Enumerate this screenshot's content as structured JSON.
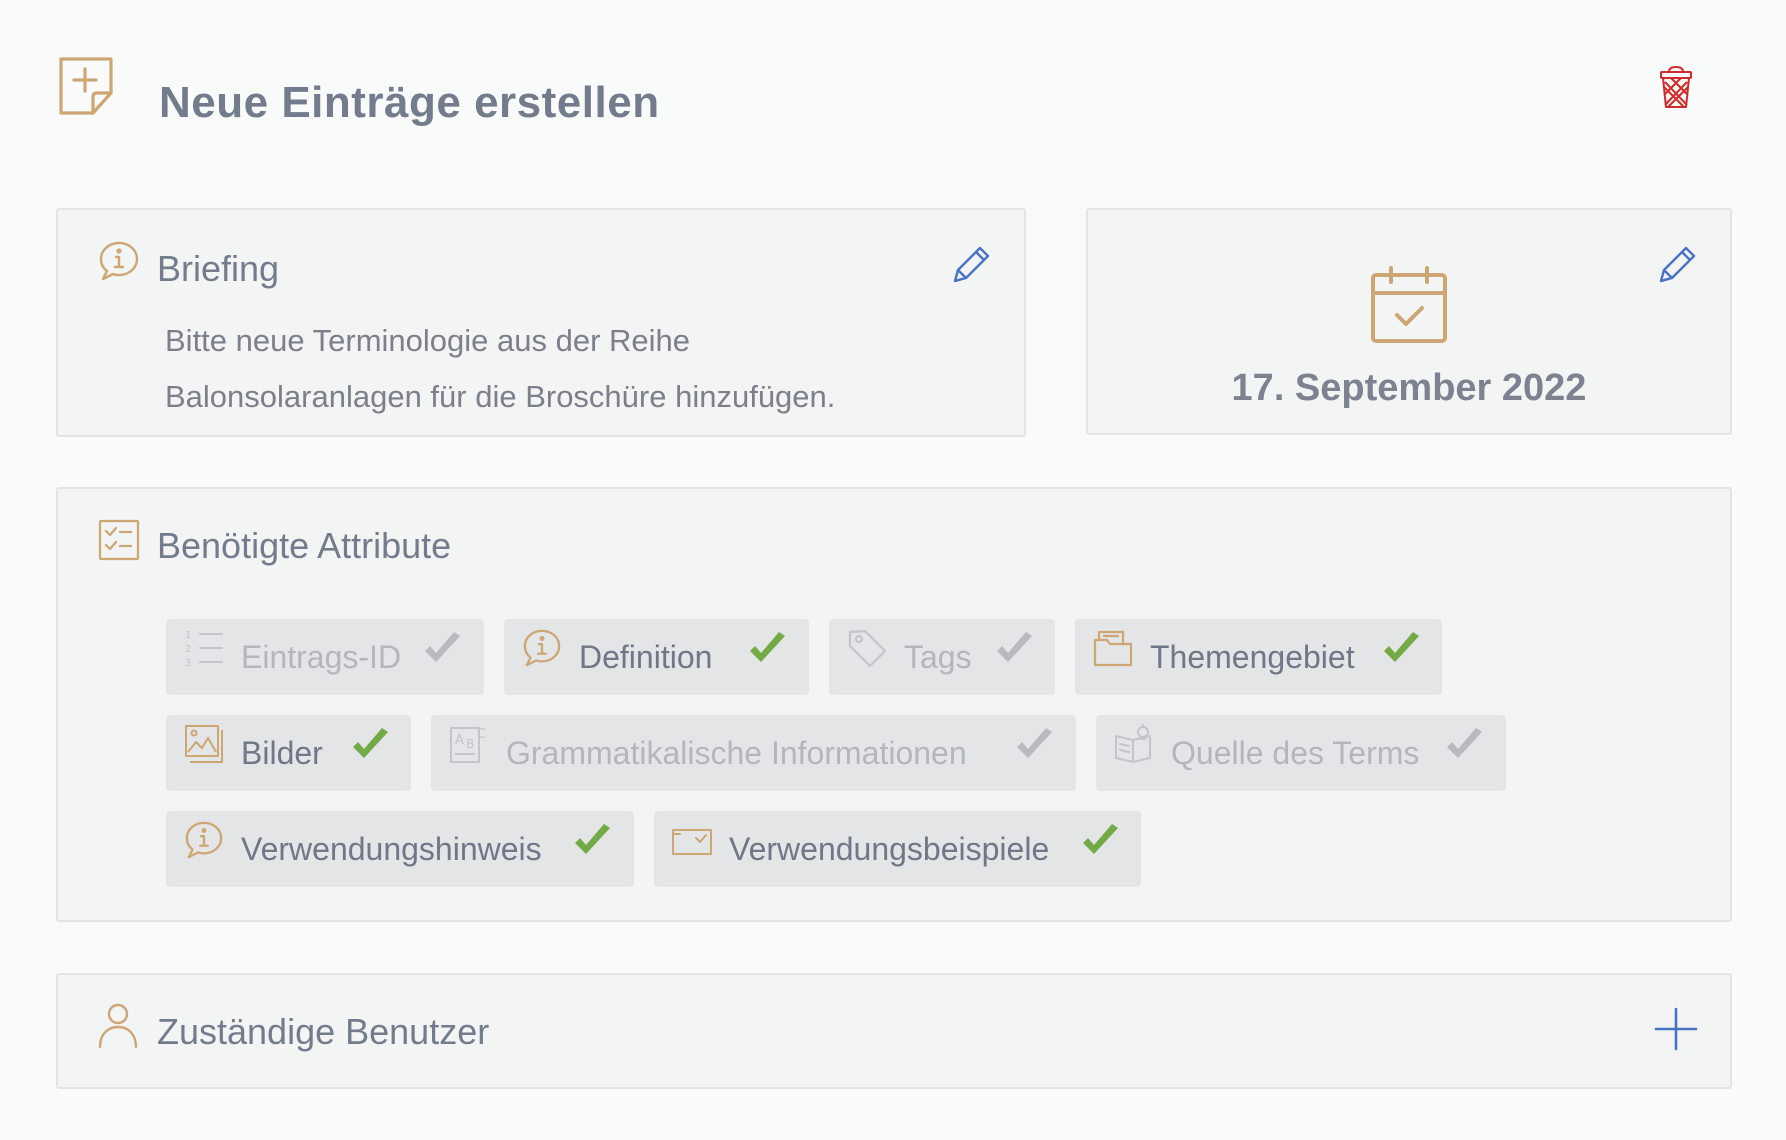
{
  "header": {
    "title": "Neue Einträge erstellen",
    "icon": "note-add-icon",
    "delete_icon": "trash-icon"
  },
  "briefing": {
    "title": "Briefing",
    "line1": "Bitte neue Terminologie aus der Reihe",
    "line2": "Balonsolaranlagen für die Broschüre hinzufügen."
  },
  "deadline": {
    "date": "17. September 2022"
  },
  "attributes": {
    "title": "Benötigte Attribute",
    "items": [
      {
        "label": "Eintrags-ID",
        "selected": false,
        "icon": "numbered-list-icon"
      },
      {
        "label": "Definition",
        "selected": true,
        "icon": "info-bubble-icon"
      },
      {
        "label": "Tags",
        "selected": false,
        "icon": "tag-icon"
      },
      {
        "label": "Themengebiet",
        "selected": true,
        "icon": "folder-icon"
      },
      {
        "label": "Bilder",
        "selected": true,
        "icon": "images-icon"
      },
      {
        "label": "Grammatikalische Informationen",
        "selected": false,
        "icon": "grammar-icon"
      },
      {
        "label": "Quelle des Terms",
        "selected": false,
        "icon": "book-idea-icon"
      },
      {
        "label": "Verwendungshinweis",
        "selected": true,
        "icon": "info-bubble-icon"
      },
      {
        "label": "Verwendungsbeispiele",
        "selected": true,
        "icon": "example-icon"
      }
    ]
  },
  "users": {
    "title": "Zuständige Benutzer"
  },
  "colors": {
    "accent": "#cda674",
    "check_on": "#72aa45",
    "check_off": "#b7babf",
    "edit": "#4a72c4",
    "delete": "#d22a2a"
  }
}
